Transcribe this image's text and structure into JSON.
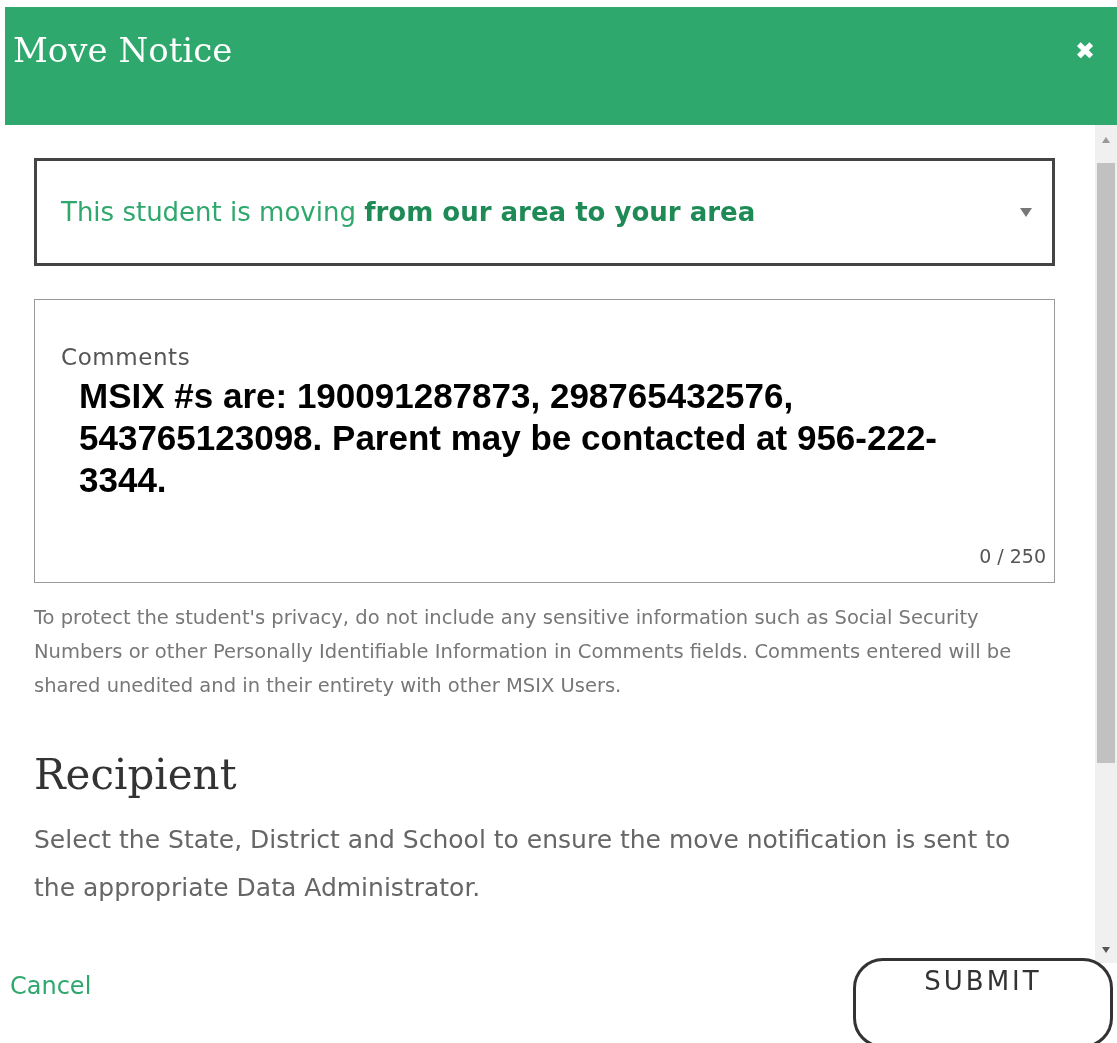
{
  "dialog": {
    "title": "Move Notice",
    "close": "✖"
  },
  "move_select": {
    "value": "This student is moving **from our area to your area**"
  },
  "comments": {
    "label": "Comments",
    "value": "MSIX #s are:  190091287873, 298765432576, 543765123098. Parent may be contacted at 956-222-3344.",
    "counter": "0 / 250"
  },
  "privacy_note": "To protect the student's privacy, do not include any sensitive information such as Social Security Numbers or other Personally Identifiable Information in Comments fields. Comments entered will be shared unedited and in their entirety with other MSIX Users.",
  "recipient": {
    "heading": "Recipient",
    "description": "Select the State, District and School to ensure the move notification is sent to the appropriate Data Administrator."
  },
  "buttons": {
    "cancel": "Cancel",
    "submit": "SUBMIT"
  }
}
